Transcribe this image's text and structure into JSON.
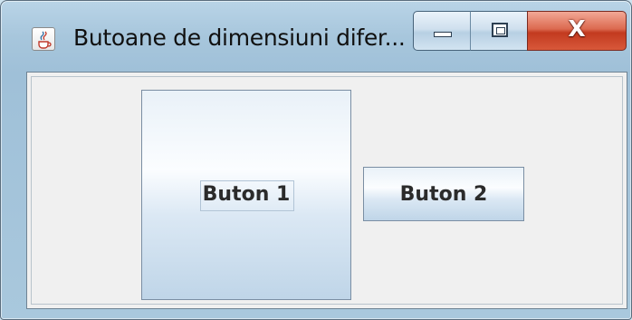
{
  "window": {
    "title": "Butoane de dimensiuni difer...",
    "icon": "java-cup-icon",
    "controls": {
      "minimize_icon": "minimize-icon",
      "maximize_icon": "maximize-icon",
      "close_label": "X"
    }
  },
  "content": {
    "buttons": [
      {
        "label": "Buton 1",
        "focused": true
      },
      {
        "label": "Buton 2",
        "focused": false
      }
    ]
  },
  "colors": {
    "close_button": "#c23a1f",
    "client_background": "#f0f0f0",
    "button_border": "#7a8ea3"
  }
}
